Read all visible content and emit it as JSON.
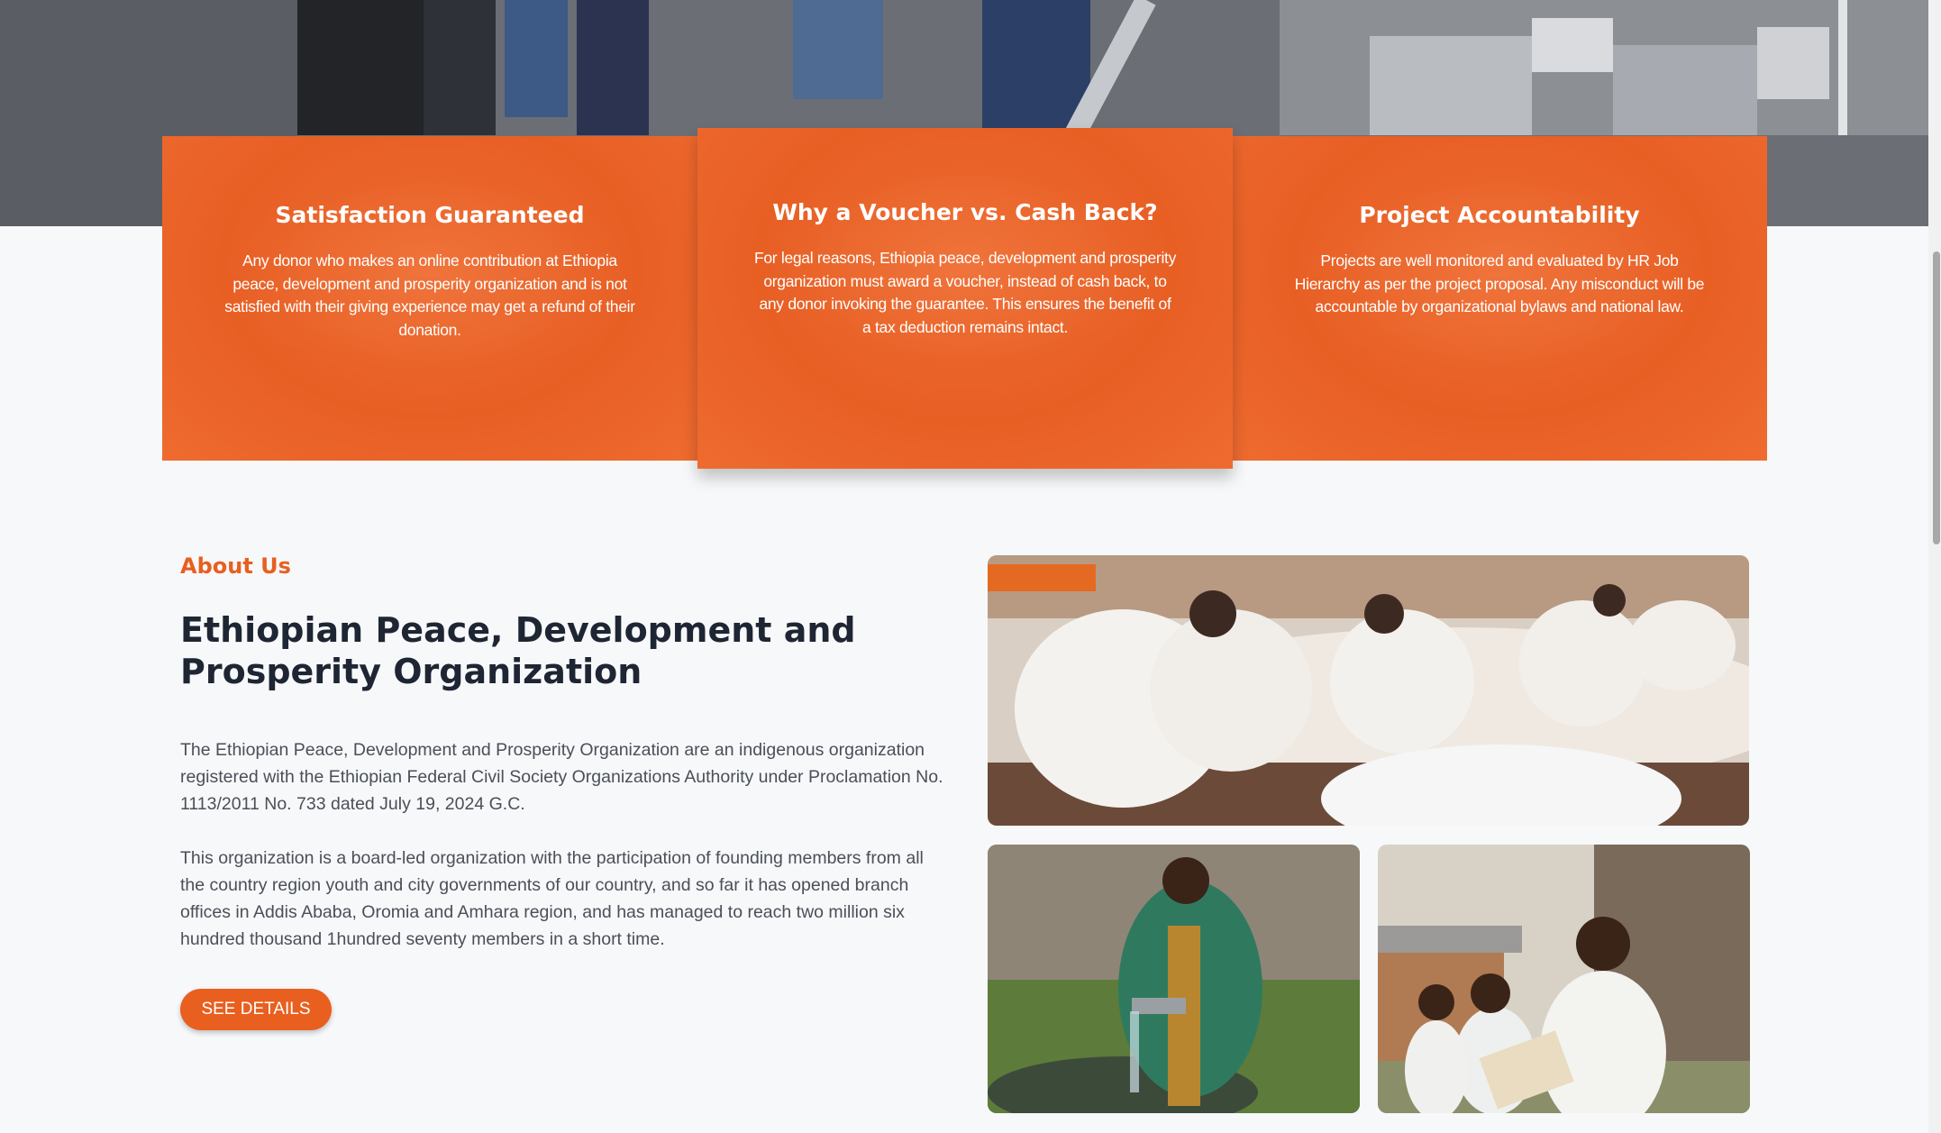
{
  "features": [
    {
      "title": "Satisfaction Guaranteed",
      "text": "Any donor who makes an online contribution at Ethiopia peace, development and prosperity organization and is not satisfied with their giving experience may get a refund of their donation."
    },
    {
      "title": "Why a Voucher vs. Cash Back?",
      "text": "For legal reasons, Ethiopia peace, development and prosperity organization must award a voucher, instead of cash back, to any donor invoking the guarantee. This ensures the benefit of a tax deduction remains intact."
    },
    {
      "title": "Project Accountability",
      "text": "Projects are well monitored and evaluated by HR Job Hierarchy as per the project proposal. Any misconduct will be accountable by organizational bylaws and national law."
    }
  ],
  "about": {
    "label": "About Us",
    "title": "Ethiopian Peace, Development and Prosperity Organization",
    "paragraphs": [
      "The Ethiopian Peace, Development and Prosperity Organization are an indigenous organization registered with the Ethiopian Federal Civil Society Organizations Authority under Proclamation No. 1113/2011 No. 733 dated July 19, 2024 G.C.",
      "This organization is a board-led organization with the participation of founding members from all the country region youth and city governments of our country, and so far it has opened branch offices in Addis Ababa, Oromia and Amhara region, and has managed to reach two million six hundred thousand 1hundred seventy members in a short time."
    ],
    "button_label": "SEE DETAILS"
  },
  "colors": {
    "accent": "#e85f1f",
    "card_orange": "#e85f24",
    "title_dark": "#1e2533",
    "body_text": "#4a4f58",
    "page_bg": "#f7f8fa"
  }
}
